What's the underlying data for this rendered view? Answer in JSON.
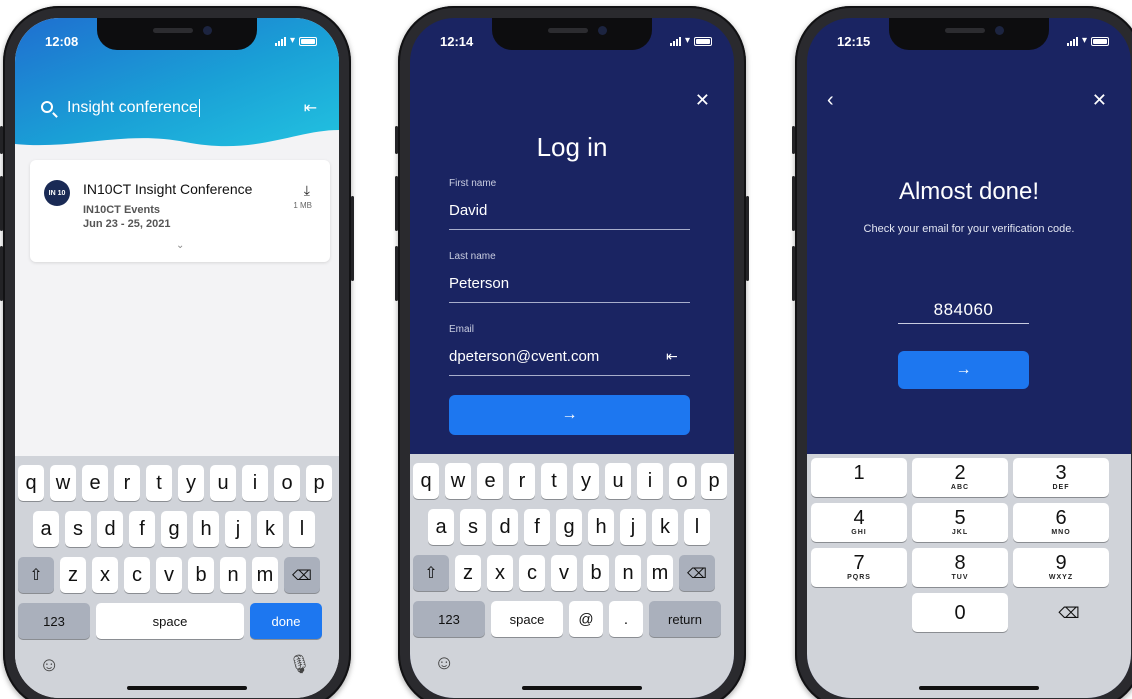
{
  "status_times": [
    "12:08",
    "12:14",
    "12:15"
  ],
  "search_screen": {
    "query": "Insight conference",
    "result": {
      "logo_text": "IN 10",
      "title": "IN10CT Insight Conference",
      "organizer": "IN10CT Events",
      "dates": "Jun 23 - 25, 2021",
      "download_size": "1 MB"
    },
    "keyboard": {
      "row1": [
        "q",
        "w",
        "e",
        "r",
        "t",
        "y",
        "u",
        "i",
        "o",
        "p"
      ],
      "row2": [
        "a",
        "s",
        "d",
        "f",
        "g",
        "h",
        "j",
        "k",
        "l"
      ],
      "row3": [
        "z",
        "x",
        "c",
        "v",
        "b",
        "n",
        "m"
      ],
      "numbers_key": "123",
      "space_key": "space",
      "action_key": "done"
    }
  },
  "login_screen": {
    "title": "Log in",
    "first_name_label": "First name",
    "first_name_value": "David",
    "last_name_label": "Last name",
    "last_name_value": "Peterson",
    "email_label": "Email",
    "email_value": "dpeterson@cvent.com",
    "keyboard": {
      "row1": [
        "q",
        "w",
        "e",
        "r",
        "t",
        "y",
        "u",
        "i",
        "o",
        "p"
      ],
      "row2": [
        "a",
        "s",
        "d",
        "f",
        "g",
        "h",
        "j",
        "k",
        "l"
      ],
      "row3": [
        "z",
        "x",
        "c",
        "v",
        "b",
        "n",
        "m"
      ],
      "numbers_key": "123",
      "space_key": "space",
      "at_key": "@",
      "dot_key": ".",
      "action_key": "return"
    }
  },
  "verify_screen": {
    "title": "Almost done!",
    "subtitle": "Check your email for your verification code.",
    "code": "884060",
    "numpad": [
      {
        "d": "1",
        "l": ""
      },
      {
        "d": "2",
        "l": "ABC"
      },
      {
        "d": "3",
        "l": "DEF"
      },
      {
        "d": "4",
        "l": "GHI"
      },
      {
        "d": "5",
        "l": "JKL"
      },
      {
        "d": "6",
        "l": "MNO"
      },
      {
        "d": "7",
        "l": "PQRS"
      },
      {
        "d": "8",
        "l": "TUV"
      },
      {
        "d": "9",
        "l": "WXYZ"
      },
      {
        "d": "0",
        "l": ""
      }
    ]
  },
  "colors": {
    "navy": "#1a2462",
    "accent_blue": "#1d77f0",
    "keyboard_bg": "#d0d3d9"
  }
}
